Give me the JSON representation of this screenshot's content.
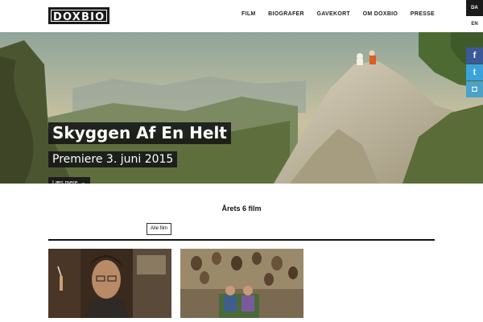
{
  "header": {
    "logo_text": "DOXBIO",
    "nav": [
      "FILM",
      "BIOGRAFER",
      "GAVEKORT",
      "OM DOXBIO",
      "PRESSE"
    ],
    "languages": [
      {
        "code": "DA",
        "active": true
      },
      {
        "code": "EN",
        "active": false
      }
    ]
  },
  "hero": {
    "title": "Skyggen Af En Helt",
    "premiere": "Premiere 3. juni 2015",
    "more_label": "Læs mere",
    "more_arrow": "→",
    "slides": [
      true,
      false,
      false
    ]
  },
  "social": [
    {
      "name": "facebook-icon",
      "glyph": "f",
      "color": "#3b5998"
    },
    {
      "name": "twitter-icon",
      "glyph": "t",
      "color": "#3aa3dd"
    },
    {
      "name": "instagram-icon",
      "glyph": "◘",
      "color": "#4aa2c9"
    }
  ],
  "films": {
    "heading": "Årets 6 film",
    "filter_label": "Alle film"
  }
}
